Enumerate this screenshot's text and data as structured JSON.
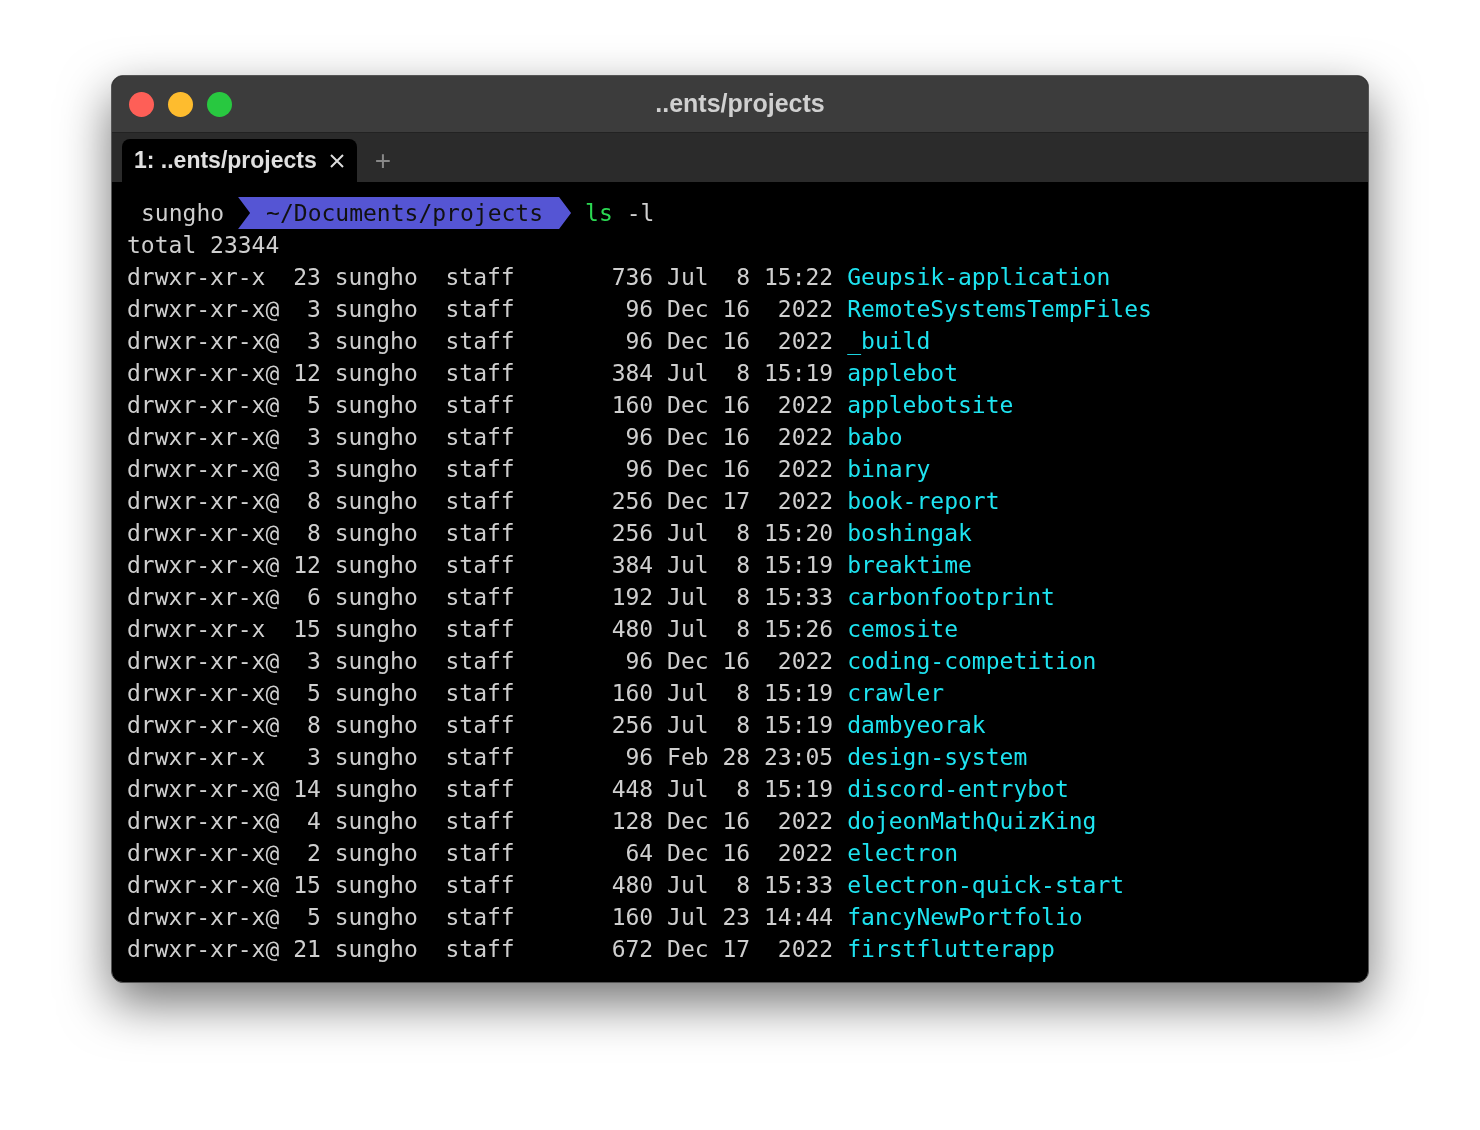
{
  "window": {
    "title": "..ents/projects"
  },
  "tabs": [
    {
      "label": "1: ..ents/projects",
      "selected": true
    }
  ],
  "new_tab": "+",
  "prompt": {
    "user": "sungho",
    "path": "~/Documents/projects",
    "command": "ls",
    "args": "-l"
  },
  "total": "total 23344",
  "rows": [
    {
      "info": "drwxr-xr-x  23 sungho  staff       736 Jul  8 15:22",
      "name": "Geupsik-application"
    },
    {
      "info": "drwxr-xr-x@  3 sungho  staff        96 Dec 16  2022",
      "name": "RemoteSystemsTempFiles"
    },
    {
      "info": "drwxr-xr-x@  3 sungho  staff        96 Dec 16  2022",
      "name": "_build"
    },
    {
      "info": "drwxr-xr-x@ 12 sungho  staff       384 Jul  8 15:19",
      "name": "applebot"
    },
    {
      "info": "drwxr-xr-x@  5 sungho  staff       160 Dec 16  2022",
      "name": "applebotsite"
    },
    {
      "info": "drwxr-xr-x@  3 sungho  staff        96 Dec 16  2022",
      "name": "babo"
    },
    {
      "info": "drwxr-xr-x@  3 sungho  staff        96 Dec 16  2022",
      "name": "binary"
    },
    {
      "info": "drwxr-xr-x@  8 sungho  staff       256 Dec 17  2022",
      "name": "book-report"
    },
    {
      "info": "drwxr-xr-x@  8 sungho  staff       256 Jul  8 15:20",
      "name": "boshingak"
    },
    {
      "info": "drwxr-xr-x@ 12 sungho  staff       384 Jul  8 15:19",
      "name": "breaktime"
    },
    {
      "info": "drwxr-xr-x@  6 sungho  staff       192 Jul  8 15:33",
      "name": "carbonfootprint"
    },
    {
      "info": "drwxr-xr-x  15 sungho  staff       480 Jul  8 15:26",
      "name": "cemosite"
    },
    {
      "info": "drwxr-xr-x@  3 sungho  staff        96 Dec 16  2022",
      "name": "coding-competition"
    },
    {
      "info": "drwxr-xr-x@  5 sungho  staff       160 Jul  8 15:19",
      "name": "crawler"
    },
    {
      "info": "drwxr-xr-x@  8 sungho  staff       256 Jul  8 15:19",
      "name": "dambyeorak"
    },
    {
      "info": "drwxr-xr-x   3 sungho  staff        96 Feb 28 23:05",
      "name": "design-system"
    },
    {
      "info": "drwxr-xr-x@ 14 sungho  staff       448 Jul  8 15:19",
      "name": "discord-entrybot"
    },
    {
      "info": "drwxr-xr-x@  4 sungho  staff       128 Dec 16  2022",
      "name": "dojeonMathQuizKing"
    },
    {
      "info": "drwxr-xr-x@  2 sungho  staff        64 Dec 16  2022",
      "name": "electron"
    },
    {
      "info": "drwxr-xr-x@ 15 sungho  staff       480 Jul  8 15:33",
      "name": "electron-quick-start"
    },
    {
      "info": "drwxr-xr-x@  5 sungho  staff       160 Jul 23 14:44",
      "name": "fancyNewPortfolio"
    },
    {
      "info": "drwxr-xr-x@ 21 sungho  staff       672 Dec 17  2022",
      "name": "firstflutterapp"
    }
  ]
}
